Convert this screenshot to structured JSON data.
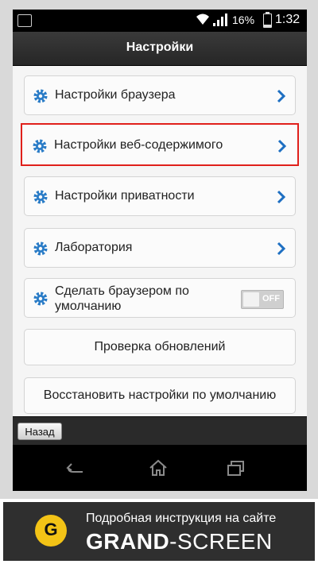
{
  "status_bar": {
    "battery_percent": "16%",
    "battery_level": 0.16,
    "time": "1:32"
  },
  "app_bar": {
    "title": "Настройки"
  },
  "settings": {
    "items": [
      {
        "label": "Настройки браузера"
      },
      {
        "label": "Настройки веб-содержимого"
      },
      {
        "label": "Настройки приватности"
      },
      {
        "label": "Лаборатория"
      }
    ],
    "default_browser": {
      "label": "Сделать браузером по умолчанию",
      "toggle_state": "OFF"
    },
    "check_updates": {
      "label": "Проверка обновлений"
    },
    "restore_defaults": {
      "label": "Восстановить настройки по умолчанию"
    }
  },
  "bottom_bar": {
    "back_label": "Назад"
  },
  "banner": {
    "caption": "Подробная инструкция на сайте",
    "brand_bold": "GRAND",
    "brand_sep": "-",
    "brand_rest": "SCREEN",
    "logo_letter": "G"
  },
  "colors": {
    "highlight": "#e0201b",
    "gear": "#2a7cc7",
    "chevron": "#1e6fc2",
    "logo": "#f3c316"
  },
  "icons": [
    "notification-icon",
    "wifi-icon",
    "signal-icon",
    "battery-icon",
    "gear-icon",
    "chevron-right-icon",
    "back-nav-icon",
    "home-nav-icon",
    "recents-nav-icon"
  ]
}
